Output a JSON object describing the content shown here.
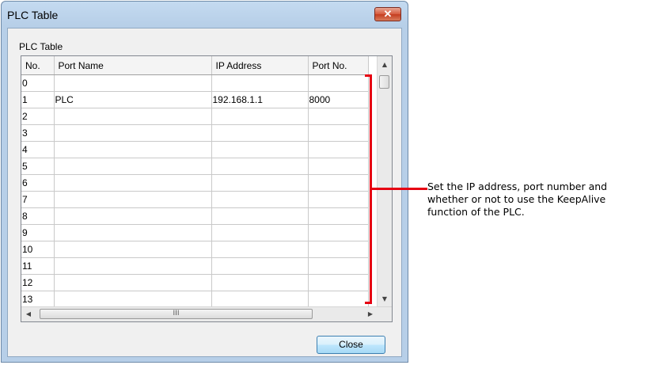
{
  "window": {
    "title": "PLC Table",
    "close_glyph": "✕"
  },
  "section_label": "PLC Table",
  "table": {
    "columns": [
      "No.",
      "Port Name",
      "IP Address",
      "Port No."
    ],
    "rows": [
      {
        "no": "0",
        "port_name": "",
        "ip": "",
        "port_no": ""
      },
      {
        "no": "1",
        "port_name": "PLC",
        "ip": "192.168.1.1",
        "port_no": "8000"
      },
      {
        "no": "2",
        "port_name": "",
        "ip": "",
        "port_no": ""
      },
      {
        "no": "3",
        "port_name": "",
        "ip": "",
        "port_no": ""
      },
      {
        "no": "4",
        "port_name": "",
        "ip": "",
        "port_no": ""
      },
      {
        "no": "5",
        "port_name": "",
        "ip": "",
        "port_no": ""
      },
      {
        "no": "6",
        "port_name": "",
        "ip": "",
        "port_no": ""
      },
      {
        "no": "7",
        "port_name": "",
        "ip": "",
        "port_no": ""
      },
      {
        "no": "8",
        "port_name": "",
        "ip": "",
        "port_no": ""
      },
      {
        "no": "9",
        "port_name": "",
        "ip": "",
        "port_no": ""
      },
      {
        "no": "10",
        "port_name": "",
        "ip": "",
        "port_no": ""
      },
      {
        "no": "11",
        "port_name": "",
        "ip": "",
        "port_no": ""
      },
      {
        "no": "12",
        "port_name": "",
        "ip": "",
        "port_no": ""
      },
      {
        "no": "13",
        "port_name": "",
        "ip": "",
        "port_no": ""
      }
    ]
  },
  "scrollbar": {
    "up": "▲",
    "down": "▼",
    "left": "◀",
    "right": "▶",
    "grip": "III"
  },
  "buttons": {
    "close": "Close"
  },
  "annotation": {
    "text": "Set the IP address, port number and whether or not to use the KeepAlive function of the PLC.",
    "color": "#e60012"
  }
}
